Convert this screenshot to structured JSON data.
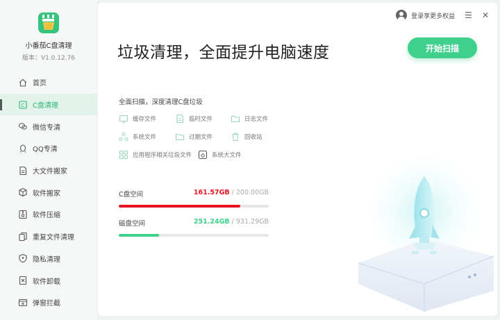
{
  "app": {
    "name": "小番茄C盘清理",
    "version": "版本：V1.0.12.76"
  },
  "sidebar": {
    "items": [
      {
        "label": "首页",
        "icon": "home-icon",
        "active": false
      },
      {
        "label": "C盘清理",
        "icon": "drive-c-icon",
        "active": true
      },
      {
        "label": "微信专清",
        "icon": "wechat-icon",
        "active": false
      },
      {
        "label": "QQ专清",
        "icon": "qq-icon",
        "active": false
      },
      {
        "label": "大文件搬家",
        "icon": "big-file-icon",
        "active": false
      },
      {
        "label": "软件搬家",
        "icon": "software-move-icon",
        "active": false
      },
      {
        "label": "软件压缩",
        "icon": "compress-icon",
        "active": false
      },
      {
        "label": "重复文件清理",
        "icon": "duplicate-file-icon",
        "active": false
      },
      {
        "label": "隐私清理",
        "icon": "privacy-icon",
        "active": false
      },
      {
        "label": "软件卸载",
        "icon": "uninstall-icon",
        "active": false
      },
      {
        "label": "弹窗拦截",
        "icon": "popup-block-icon",
        "active": false
      }
    ]
  },
  "topbar": {
    "login_label": "登录享更多权益"
  },
  "main": {
    "headline": "垃圾清理，全面提升电脑速度",
    "scan_button": "开始扫描",
    "description": "全面扫描，深度清理C盘垃圾",
    "categories": [
      {
        "label": "缓存文件",
        "icon": "cache-file-icon"
      },
      {
        "label": "临时文件",
        "icon": "temp-file-icon"
      },
      {
        "label": "日志文件",
        "icon": "log-file-icon"
      },
      {
        "label": "系统文件",
        "icon": "system-file-icon"
      },
      {
        "label": "过期文件",
        "icon": "expired-file-icon"
      },
      {
        "label": "回收站",
        "icon": "recycle-bin-icon"
      },
      {
        "label": "应用程序相关垃圾文件",
        "icon": "app-junk-icon"
      },
      {
        "label": "系统大文件",
        "icon": "system-big-file-icon"
      }
    ],
    "storage": [
      {
        "label": "C盘空间",
        "used": "161.57GB",
        "separator": " / ",
        "total": "200.00GB",
        "fraction": 0.808,
        "color": "#e8141e"
      },
      {
        "label": "磁盘空间",
        "used": "251.24GB",
        "separator": " / ",
        "total": "931.29GB",
        "fraction": 0.27,
        "color": "#3fd18c"
      }
    ]
  },
  "colors": {
    "accent": "#3fd18c",
    "active_nav_bg": "#e2f3ec",
    "active_nav_text": "#2bb673"
  }
}
